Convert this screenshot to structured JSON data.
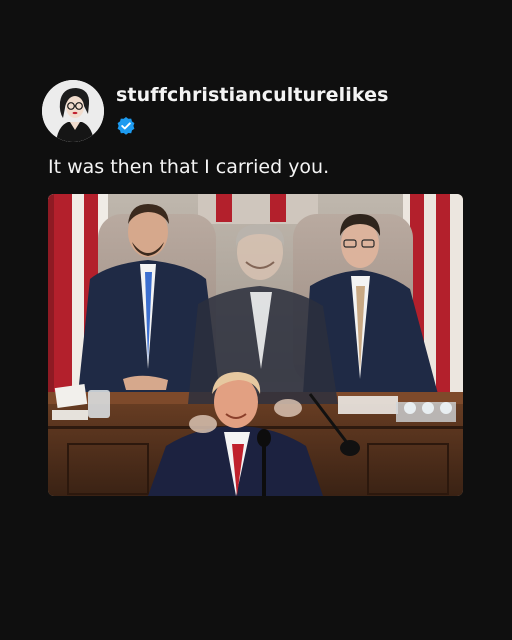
{
  "post": {
    "username": "stuffchristianculturelikes",
    "verified": true,
    "caption": "It was then that I carried you."
  },
  "icons": {
    "avatar": "illustrated-woman-avatar",
    "badge": "verified-badge-icon"
  },
  "colors": {
    "background": "#0f0f0f",
    "text": "#f4f4f4",
    "verified_badge": "#1d9bf0"
  }
}
